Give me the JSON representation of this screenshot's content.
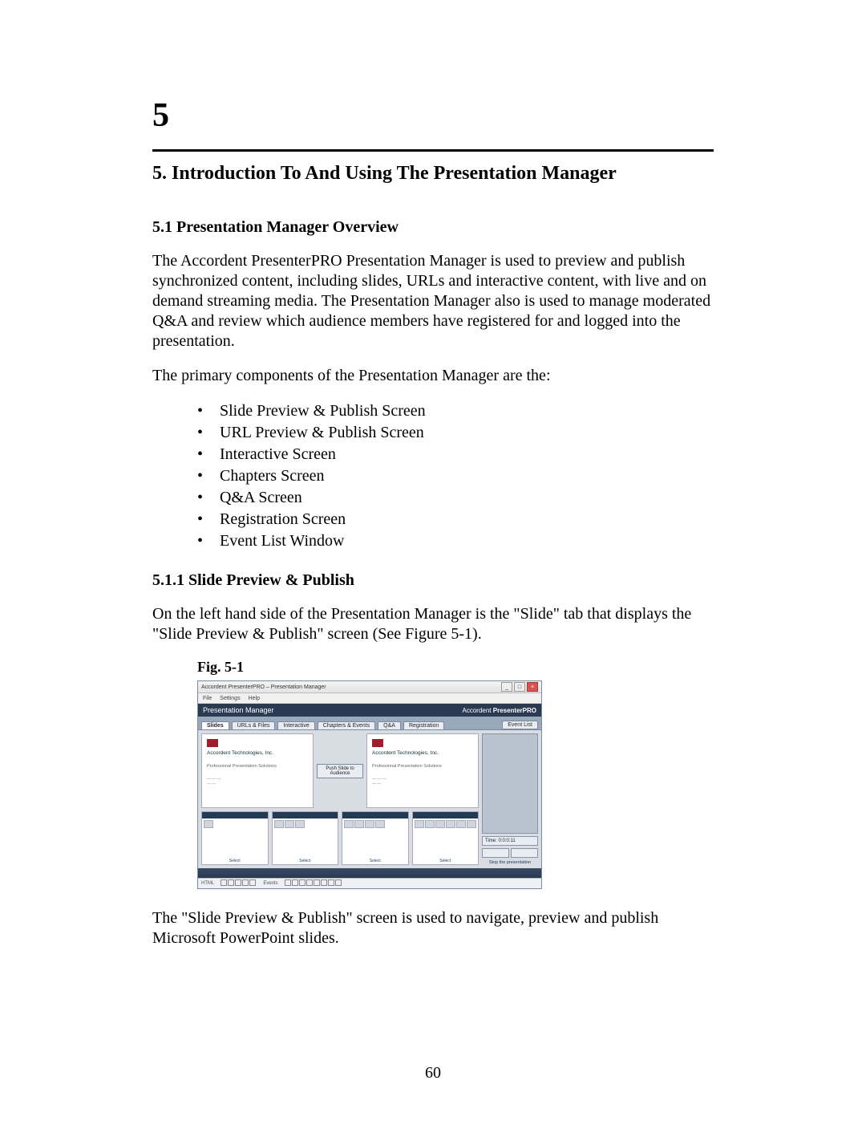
{
  "chapter_number": "5",
  "section_title": "5.  Introduction To And Using The Presentation Manager",
  "subsection_title": "5.1  Presentation Manager Overview",
  "paragraph_overview": "The Accordent PresenterPRO Presentation Manager is used to preview and publish synchronized content, including slides, URLs and interactive content, with live and on demand streaming media.  The Presentation Manager also is used to manage moderated Q&A and review which audience members have registered for and logged into the presentation.",
  "paragraph_components_intro": "The primary components of the Presentation Manager are the:",
  "components": [
    "Slide Preview & Publish Screen",
    "URL Preview & Publish Screen",
    "Interactive Screen",
    "Chapters Screen",
    "Q&A Screen",
    "Registration Screen",
    "Event List Window"
  ],
  "subsubsection_title": "5.1.1  Slide Preview & Publish",
  "paragraph_slide_intro": "On the left hand side of the Presentation Manager is the \"Slide\" tab that displays the \"Slide Preview & Publish\" screen (See Figure 5-1).",
  "figure_label": "Fig. 5-1",
  "paragraph_slide_desc": "The \"Slide Preview & Publish\" screen is used to navigate, preview and publish Microsoft PowerPoint slides.",
  "page_number": "60",
  "screenshot": {
    "window_title": "Accordent PresenterPRO – Presentation Manager",
    "menus": [
      "File",
      "Settings",
      "Help"
    ],
    "header_title": "Presentation Manager",
    "header_brand_prefix": "Accordent ",
    "header_brand_bold": "PresenterPRO",
    "tabs": [
      "Slides",
      "URLs & Files",
      "Interactive",
      "Chapters & Events",
      "Q&A",
      "Registration"
    ],
    "active_tab_index": 0,
    "side_button": "Event List",
    "push_button": "Push Slide to Audience",
    "slide_company": "Accordent Technologies, Inc.",
    "slide_tagline": "Professional Presentation Solutions",
    "thumb_footer": "Select",
    "time_label": "Time:",
    "time_value": "0:0:0:11",
    "stop_label": "Stop the presentation",
    "statusbar_left": "HTML",
    "statusbar_mid": "Events"
  }
}
